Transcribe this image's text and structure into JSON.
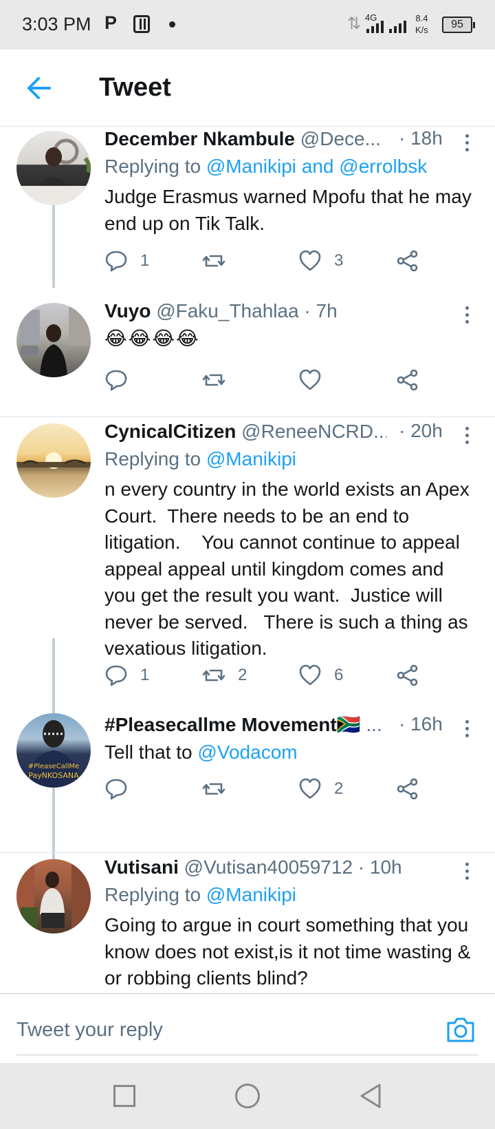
{
  "status_bar": {
    "time": "3:03 PM",
    "p_icon": "P",
    "network": "4G",
    "speed_value": "8.4",
    "speed_unit": "K/s",
    "battery": "95"
  },
  "header": {
    "title": "Tweet",
    "back_icon": "arrow-left-icon"
  },
  "colors": {
    "accent": "#1da1f2",
    "text": "#14171a",
    "secondary": "#5b7083",
    "divider": "#dde3e8"
  },
  "tweets": [
    {
      "name": "December Nkambule",
      "handle": "@Dece...",
      "time": "· 18h",
      "replying_label": "Replying to",
      "replying_to": "@Manikipi and @errolbsk",
      "text": "Judge Erasmus warned Mpofu that he may end up on Tik Talk.",
      "replies": "1",
      "retweets": "",
      "likes": "3"
    },
    {
      "name": "Vuyo",
      "handle": "@Faku_Thahlaa · 7h",
      "time": "",
      "text": "😂😂😂😂",
      "replies": "",
      "retweets": "",
      "likes": ""
    },
    {
      "name": "CynicalCitizen",
      "handle": "@ReneeNCRD...",
      "time": "· 20h",
      "replying_label": "Replying to",
      "replying_to": "@Manikipi",
      "text": "n every country in the world exists an Apex Court.  There needs to be an end to litigation.    You cannot continue to appeal appeal appeal until kingdom comes and you get the result you want.  Justice will never be served.   There is such a thing as vexatious litigation.",
      "replies": "1",
      "retweets": "2",
      "likes": "6"
    },
    {
      "name": "#Pleasecallme Movement🇿🇦",
      "handle": "...",
      "time": "· 16h",
      "text_prefix": "Tell that to",
      "text_link": "@Vodacom",
      "replies": "",
      "retweets": "",
      "likes": "2"
    },
    {
      "name": "Vutisani",
      "handle": "@Vutisan40059712 · 10h",
      "time": "",
      "replying_label": "Replying to",
      "replying_to": "@Manikipi",
      "text": "Going to argue in court something that you know does not exist,is it not time wasting & or robbing clients blind?"
    }
  ],
  "reply_bar": {
    "placeholder": "Tweet your reply",
    "camera_icon": "camera-icon"
  },
  "nav_bar": {
    "recents_icon": "square-icon",
    "home_icon": "circle-icon",
    "back_icon": "triangle-back-icon"
  }
}
